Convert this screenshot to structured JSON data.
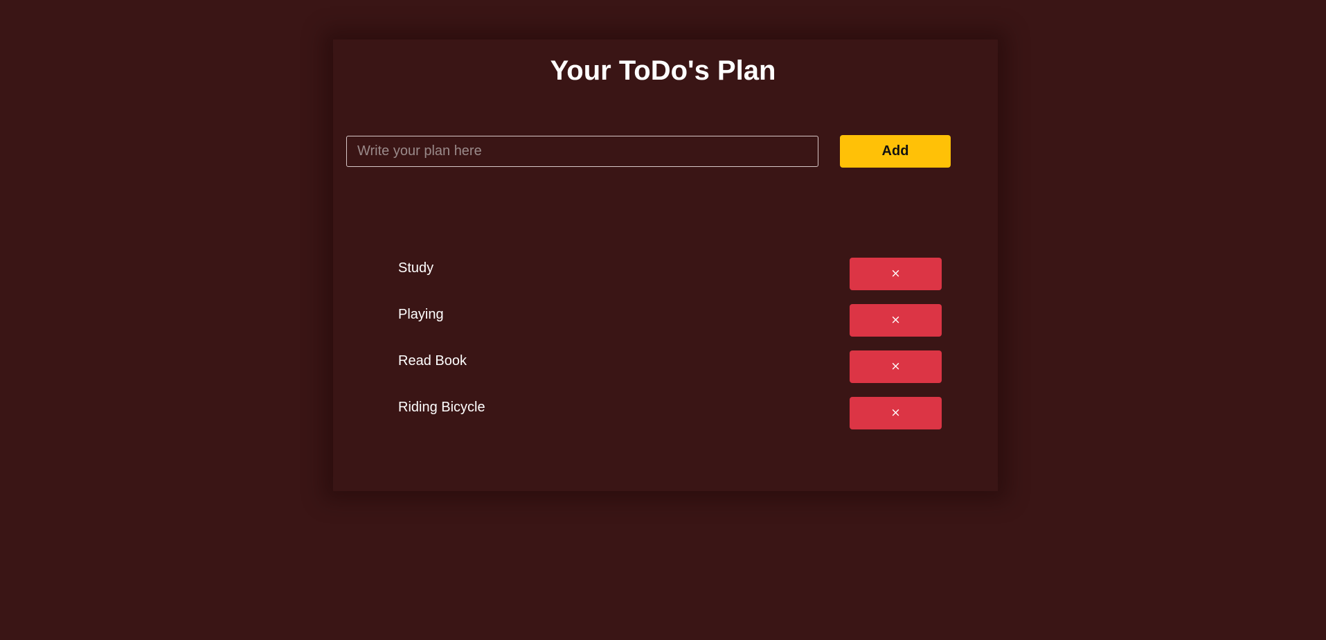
{
  "header": {
    "title": "Your ToDo's Plan"
  },
  "form": {
    "input_placeholder": "Write your plan here",
    "input_value": "",
    "add_label": "Add"
  },
  "todos": [
    {
      "text": "Study",
      "delete_label": "×"
    },
    {
      "text": "Playing",
      "delete_label": "×"
    },
    {
      "text": "Read Book",
      "delete_label": "×"
    },
    {
      "text": "Riding Bicycle",
      "delete_label": "×"
    }
  ],
  "colors": {
    "background": "#3a1515",
    "add_button": "#ffc107",
    "delete_button": "#dc3545",
    "text": "#ffffff"
  }
}
